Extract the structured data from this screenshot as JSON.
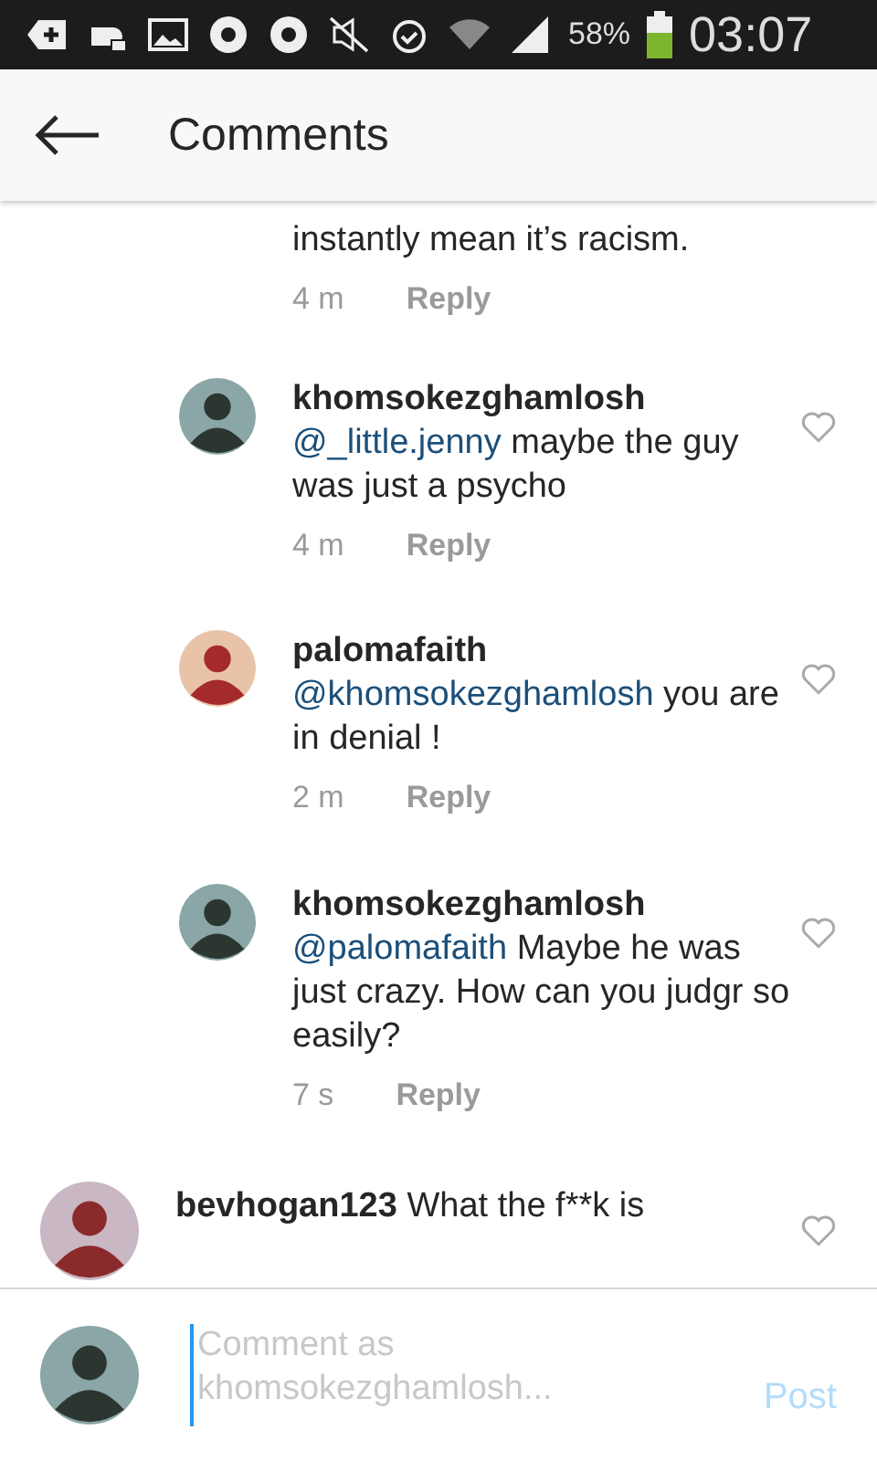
{
  "status_bar": {
    "battery": "58%",
    "time": "03:07"
  },
  "header": {
    "title": "Comments"
  },
  "top_comment": {
    "text": "instantly mean it’s racism.",
    "time": "4 m",
    "reply": "Reply"
  },
  "replies": [
    {
      "username": "khomsokezghamlosh",
      "mention": "@_little.jenny",
      "text": "maybe the guy was just a psycho",
      "time": "4 m",
      "reply": "Reply",
      "liked": false
    },
    {
      "username": "palomafaith",
      "mention": "@khomsokezghamlosh",
      "text": "you are in denial !",
      "time": "2 m",
      "reply": "Reply",
      "liked": false
    },
    {
      "username": "khomsokezghamlosh",
      "mention": "@palomafaith",
      "text": "Maybe he was just crazy. How can you judgr so easily?",
      "time": "7 s",
      "reply": "Reply",
      "liked": false
    }
  ],
  "last_comment": {
    "username": "bevhogan123",
    "text": "What the f**k is",
    "liked": false
  },
  "composer": {
    "placeholder": "Comment as khomsokezghamlosh...",
    "post": "Post"
  }
}
